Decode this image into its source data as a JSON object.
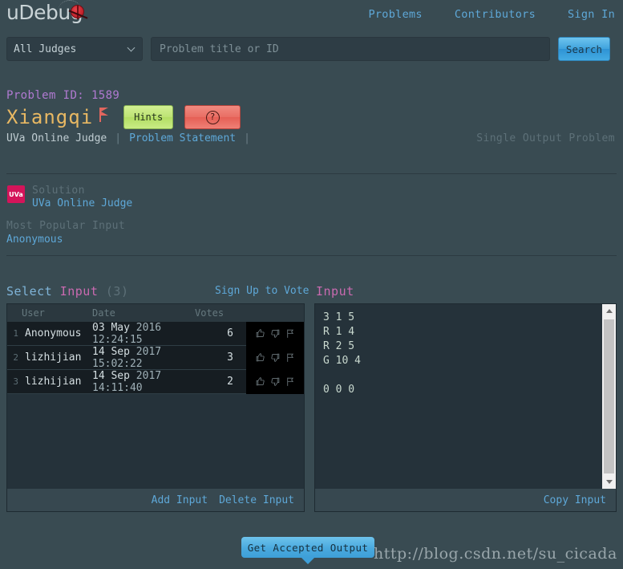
{
  "header": {
    "logo_text": "uDebug",
    "nav": [
      {
        "label": "Problems"
      },
      {
        "label": "Contributors"
      },
      {
        "label": "Sign In"
      }
    ]
  },
  "search": {
    "judge_selected": "All Judges",
    "placeholder": "Problem title or ID",
    "value": "",
    "button_label": "Search"
  },
  "problem": {
    "id_label": "Problem ID: 1589",
    "title": "Xiangqi",
    "hints_label": "Hints",
    "help_label": "?",
    "judge": "UVa Online Judge",
    "statement_link": "Problem Statement",
    "separator": "|",
    "output_type": "Single Output Problem"
  },
  "solution": {
    "badge": "UVa",
    "label": "Solution",
    "link": "UVa Online Judge"
  },
  "most_popular_input": {
    "label": "Most Popular Input",
    "value": "Anonymous"
  },
  "select_input": {
    "title_word1": "Select",
    "title_word2": "Input",
    "count": "(3)",
    "vote_link": "Sign Up to Vote",
    "columns": {
      "index": "",
      "user": "User",
      "date": "Date",
      "votes": "Votes"
    },
    "rows": [
      {
        "index": "1",
        "user": "Anonymous",
        "date_strong": "03 May",
        "date_rest": "2016 12:24:15",
        "votes": "6"
      },
      {
        "index": "2",
        "user": "lizhijian",
        "date_strong": "14 Sep",
        "date_rest": "2017 15:02:22",
        "votes": "3"
      },
      {
        "index": "3",
        "user": "lizhijian",
        "date_strong": "14 Sep",
        "date_rest": "2017 14:11:40",
        "votes": "2"
      }
    ],
    "footer": {
      "add_input": "Add Input",
      "delete_input": "Delete Input"
    }
  },
  "input_panel": {
    "title": "Input",
    "content": "3 1 5\nR 1 4\nR 2 5\nG 10 4\n\n0 0 0",
    "footer": {
      "copy_input": "Copy Input"
    }
  },
  "actions": {
    "get_accepted_output": "Get Accepted Output"
  },
  "watermark": {
    "text": "http://blog.csdn.net/su_cicada"
  },
  "colors": {
    "page_bg": "#394b52",
    "accent_link": "#5ea8d8",
    "title_yellow": "#e8b863",
    "magenta": "#c96ab0",
    "purple": "#b07ad1",
    "uva_badge": "#d4145a",
    "hints_green": "#bde374",
    "help_red": "#e96e64",
    "panel_bg": "#25323a",
    "row_bg": "#161d22"
  }
}
